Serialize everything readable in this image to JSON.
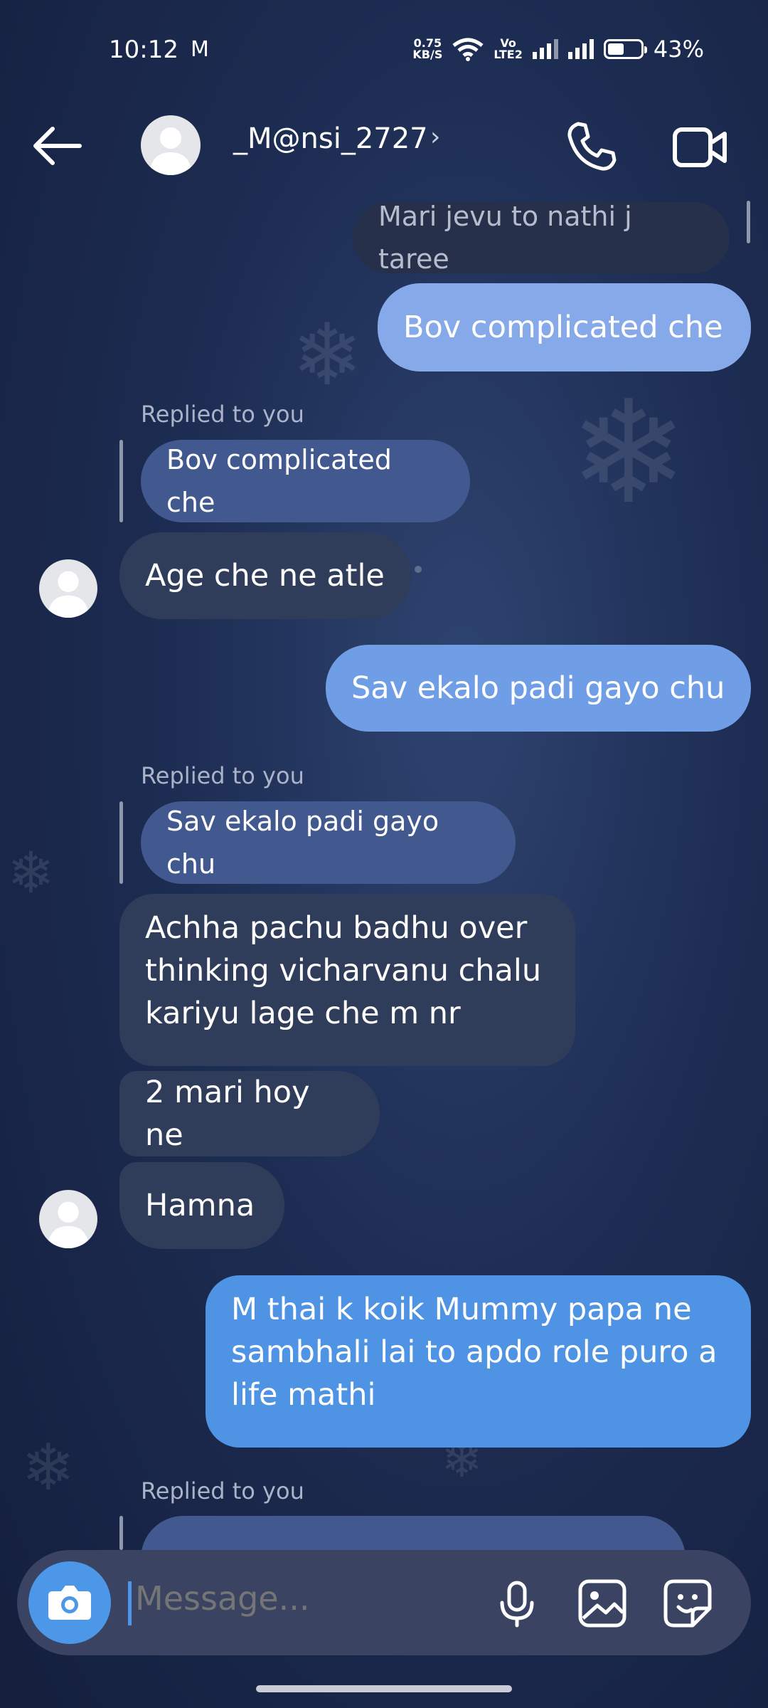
{
  "status_bar": {
    "time": "10:12",
    "mail_icon": "M",
    "net_speed_top": "0.75",
    "net_speed_bottom": "KB/S",
    "volte_top": "Vo",
    "volte_bottom": "LTE2",
    "battery": "43%"
  },
  "header": {
    "username": "_M@nsi_2727",
    "chevron": "›"
  },
  "messages": {
    "m1": "Mari jevu to nathi j taree",
    "m2": "Bov complicated che",
    "replied_label_1": "Replied to you",
    "reply_quote_1": "Bov complicated che",
    "m3": "Age che ne atle",
    "m4": "Sav ekalo padi gayo chu",
    "replied_label_2": "Replied to you",
    "reply_quote_2": "Sav ekalo padi gayo chu",
    "m5_line1": "Achha pachu badhu over",
    "m5_line2": "thinking vicharvanu chalu",
    "m5_line3": "kariyu lage che m nr",
    "m6": "2 mari hoy ne",
    "m7": "Hamna",
    "m8_line1": "M thai k koik Mummy papa ne",
    "m8_line2": "sambhali lai to apdo role puro a",
    "m8_line3": "life mathi",
    "replied_label_3": "Replied to you"
  },
  "composer": {
    "placeholder": "Message..."
  },
  "icons": {
    "back": "arrow-left-icon",
    "call": "phone-icon",
    "video": "video-camera-icon",
    "camera": "camera-icon",
    "mic": "microphone-icon",
    "gallery": "image-icon",
    "sticker": "sticker-icon"
  }
}
